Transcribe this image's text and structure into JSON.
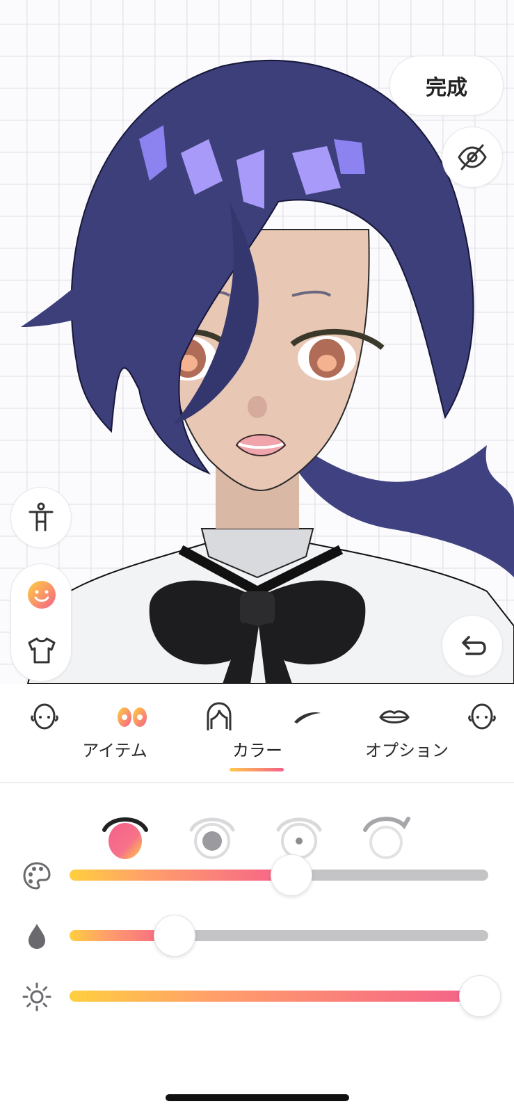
{
  "header": {
    "done_label": "完成"
  },
  "tabs": [
    {
      "label": "アイテム",
      "active": false
    },
    {
      "label": "カラー",
      "active": true
    },
    {
      "label": "オプション",
      "active": false
    }
  ],
  "parts": [
    {
      "name": "face",
      "icon": "face-outline-icon"
    },
    {
      "name": "eyes",
      "icon": "eyes-icon",
      "active": true
    },
    {
      "name": "hair",
      "icon": "hair-icon"
    },
    {
      "name": "eyebrows",
      "icon": "eyebrow-icon"
    },
    {
      "name": "mouth",
      "icon": "mouth-icon"
    },
    {
      "name": "face-2",
      "icon": "face-outline-icon"
    }
  ],
  "eye_variants": [
    {
      "icon": "eye-full-icon",
      "active": true
    },
    {
      "icon": "eye-iris-icon"
    },
    {
      "icon": "eye-pupil-icon"
    },
    {
      "icon": "eye-lash-icon"
    }
  ],
  "sliders": [
    {
      "icon": "palette-icon",
      "value": 0.53
    },
    {
      "icon": "droplet-icon",
      "value": 0.25
    },
    {
      "icon": "sun-icon",
      "value": 0.98
    }
  ],
  "side_tools": [
    "body-icon",
    "face-smile-icon",
    "shirt-icon"
  ],
  "colors": {
    "accent_start": "#ffcf3f",
    "accent_end": "#f5608a",
    "hair": "#3d3f7a",
    "skin": "#e8c7b4"
  }
}
